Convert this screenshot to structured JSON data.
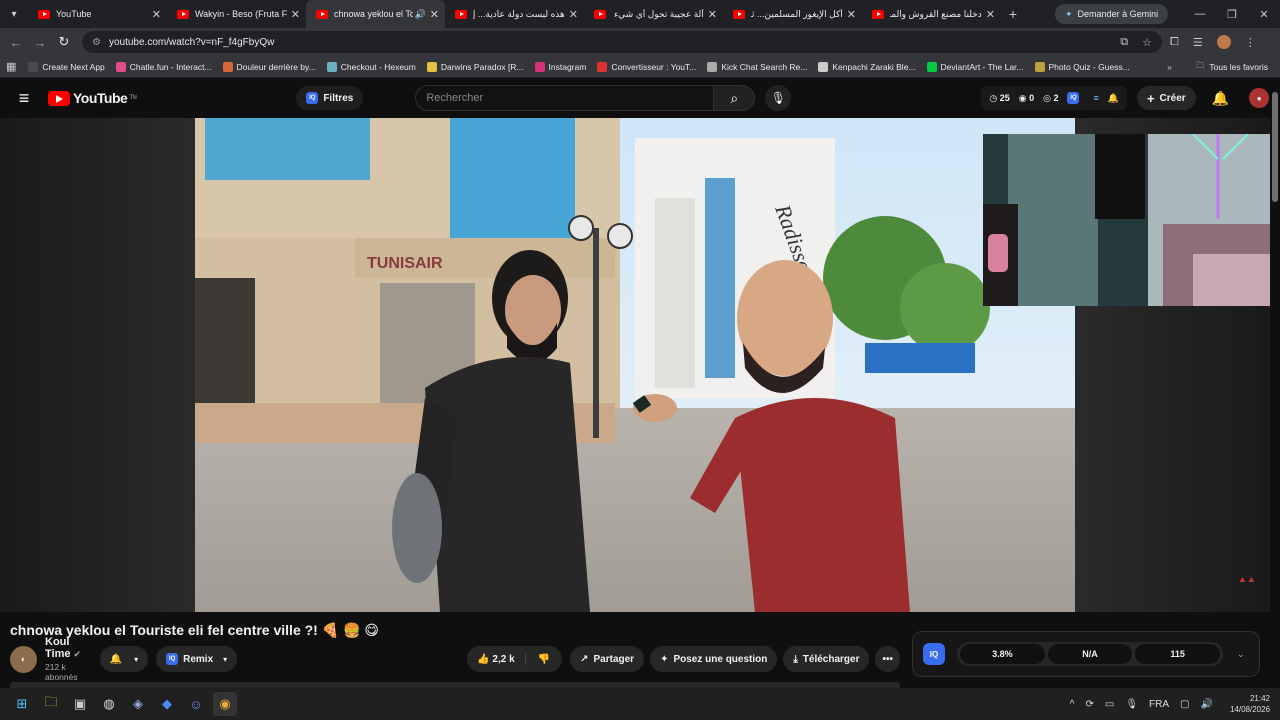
{
  "browser": {
    "tabs": [
      {
        "title": "YouTube",
        "active": false
      },
      {
        "title": "Wakyin - Beso (Fruta Fres",
        "active": false
      },
      {
        "title": "chnowa yeklou el Touriste",
        "active": true,
        "audio": true
      },
      {
        "title": "هذه ليست دولة عادية... إنها",
        "active": false
      },
      {
        "title": "آلة عجيبة تحول أي شيء إلى",
        "active": false
      },
      {
        "title": "أكل الإيغور المسلمين... ثقافة",
        "active": false
      },
      {
        "title": "دخلنا مصنع القروش والمخا",
        "active": false
      }
    ],
    "gemini_label": "Demander à Gemini",
    "url": "youtube.com/watch?v=nF_f4gFbyQw",
    "bookmarks": [
      {
        "label": "Create Next App",
        "color": "#4a4a4a"
      },
      {
        "label": "Chatle.fun - Interact...",
        "color": "#e04b8a"
      },
      {
        "label": "Douleur derrière by...",
        "color": "#d8663a"
      },
      {
        "label": "Checkout - Hexeum",
        "color": "#6ab0c0"
      },
      {
        "label": "Darwins Paradox [R...",
        "color": "#e8c040"
      },
      {
        "label": "Instagram",
        "color": "#d6307a"
      },
      {
        "label": "Convertisseur : YouT...",
        "color": "#e03030"
      },
      {
        "label": "Kick Chat Search Re...",
        "color": "#aaaaaa"
      },
      {
        "label": "Kenpachi Zaraki Ble...",
        "color": "#cccccc"
      },
      {
        "label": "DeviantArt - The Lar...",
        "color": "#05cc47"
      },
      {
        "label": "Photo Quiz - Guess...",
        "color": "#c0a040"
      }
    ],
    "bookmarks_all": "Tous les favoris"
  },
  "youtube": {
    "logo_text": "YouTube",
    "logo_region": "TN",
    "filters_label": "Filtres",
    "search_placeholder": "Rechercher",
    "stats": {
      "a": "25",
      "b": "0",
      "c": "2"
    },
    "create_label": "Créer"
  },
  "video": {
    "title": "chnowa yeklou el Touriste eli fel centre ville ?! 🍕 🍔 😋",
    "channel_name": "Koul Time",
    "subscribers": "212 k abonnés",
    "remix_label": "Remix",
    "likes": "2,2 k",
    "share_label": "Partager",
    "ask_label": "Posez une question",
    "download_label": "Télécharger",
    "sign_text": "TUNISAIR",
    "hotel_text": "Radisson"
  },
  "iq_panel": {
    "metric1": "3.8%",
    "metric2": "N/A",
    "metric3": "115"
  },
  "taskbar": {
    "lang": "FRA",
    "time": "21:42",
    "date": "14/08/2026"
  }
}
